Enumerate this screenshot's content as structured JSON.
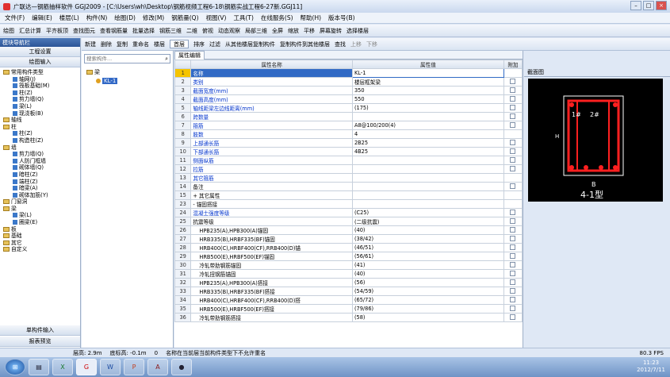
{
  "window": {
    "title": "广联达—钢筋抽样软件 GGJ2009 - [C:\\Users\\wh\\Desktop\\钢筋视频工程6-18\\钢筋实战工程6-27新.GGJ11]"
  },
  "menu": [
    "文件(F)",
    "编辑(E)",
    "楼层(L)",
    "构件(N)",
    "绘图(D)",
    "修改(M)",
    "钢筋量(Q)",
    "视图(V)",
    "工具(T)",
    "在线服务(S)",
    "帮助(H)",
    "版本号(B)"
  ],
  "toolbar1": [
    "绘图",
    "汇总计算",
    "平齐板顶",
    "查找图元",
    "查看钢筋量",
    "批量选择",
    "钢筋三维",
    "二维",
    "俯视",
    "动态观察",
    "局部三维",
    "全屏",
    "缩放",
    "平移",
    "屏幕旋转",
    "选择楼层"
  ],
  "toolbar2": {
    "new": "新建",
    "delete": "删除",
    "copy": "复制",
    "rename": "重命名",
    "floor_label": "楼层",
    "floor_value": "首层",
    "sort": "排序",
    "filter": "过滤",
    "copy_from": "从其他楼层复制构件",
    "copy_to": "复制构件到其他楼层",
    "find": "查找",
    "up": "上移",
    "down": "下移"
  },
  "left": {
    "title": "模块导航栏",
    "btn1": "工程设置",
    "btn2": "绘图输入",
    "bottom1": "单构件输入",
    "bottom2": "报表预览",
    "tree": [
      {
        "t": "常用构件类型",
        "lvl": 0,
        "k": "f"
      },
      {
        "t": "轴网(J)",
        "lvl": 1,
        "k": "c"
      },
      {
        "t": "筏板基础(M)",
        "lvl": 1,
        "k": "c"
      },
      {
        "t": "柱(Z)",
        "lvl": 1,
        "k": "c"
      },
      {
        "t": "剪力墙(Q)",
        "lvl": 1,
        "k": "c"
      },
      {
        "t": "梁(L)",
        "lvl": 1,
        "k": "c"
      },
      {
        "t": "现浇板(B)",
        "lvl": 1,
        "k": "c"
      },
      {
        "t": "轴线",
        "lvl": 0,
        "k": "f"
      },
      {
        "t": "柱",
        "lvl": 0,
        "k": "f"
      },
      {
        "t": "柱(Z)",
        "lvl": 1,
        "k": "c"
      },
      {
        "t": "构造柱(Z)",
        "lvl": 1,
        "k": "c"
      },
      {
        "t": "墙",
        "lvl": 0,
        "k": "f"
      },
      {
        "t": "剪力墙(Q)",
        "lvl": 1,
        "k": "c"
      },
      {
        "t": "人防门框墙",
        "lvl": 1,
        "k": "c"
      },
      {
        "t": "砌体墙(Q)",
        "lvl": 1,
        "k": "c"
      },
      {
        "t": "暗柱(Z)",
        "lvl": 1,
        "k": "c"
      },
      {
        "t": "端柱(Z)",
        "lvl": 1,
        "k": "c"
      },
      {
        "t": "暗梁(A)",
        "lvl": 1,
        "k": "c"
      },
      {
        "t": "砌体加筋(Y)",
        "lvl": 1,
        "k": "c"
      },
      {
        "t": "门窗洞",
        "lvl": 0,
        "k": "f"
      },
      {
        "t": "梁",
        "lvl": 0,
        "k": "f"
      },
      {
        "t": "梁(L)",
        "lvl": 1,
        "k": "c"
      },
      {
        "t": "圈梁(E)",
        "lvl": 1,
        "k": "c"
      },
      {
        "t": "板",
        "lvl": 0,
        "k": "f"
      },
      {
        "t": "基础",
        "lvl": 0,
        "k": "f"
      },
      {
        "t": "其它",
        "lvl": 0,
        "k": "f"
      },
      {
        "t": "自定义",
        "lvl": 0,
        "k": "f"
      }
    ]
  },
  "mid": {
    "search_placeholder": "搜索构件...",
    "root": "梁",
    "child": "KL-1"
  },
  "grid": {
    "tab": "属性编辑",
    "headers": [
      "属性名称",
      "属性值",
      "附加"
    ],
    "rows": [
      [
        "1",
        "名称",
        "KL-1",
        0
      ],
      [
        "2",
        "类别",
        "楼层框架梁",
        1
      ],
      [
        "3",
        "截面宽度(mm)",
        "350",
        1
      ],
      [
        "4",
        "截面高度(mm)",
        "550",
        1
      ],
      [
        "5",
        "轴线距梁左边线距离(mm)",
        "(175)",
        1
      ],
      [
        "6",
        "跨数量",
        "",
        1
      ],
      [
        "7",
        "箍筋",
        "A8@100/200(4)",
        1
      ],
      [
        "8",
        "肢数",
        "4",
        0
      ],
      [
        "9",
        "上部通长筋",
        "2B25",
        1
      ],
      [
        "10",
        "下部通长筋",
        "4B25",
        1
      ],
      [
        "11",
        "侧面纵筋",
        "",
        1
      ],
      [
        "12",
        "拉筋",
        "",
        1
      ],
      [
        "13",
        "其它箍筋",
        "",
        0
      ],
      [
        "14",
        "备注",
        "",
        1
      ],
      [
        "15",
        "+ 其它属性",
        "",
        0
      ],
      [
        "23",
        "- 锚固搭接",
        "",
        0
      ],
      [
        "24",
        "混凝土强度等级",
        "(C25)",
        1
      ],
      [
        "25",
        "抗震等级",
        "(二级抗震)",
        1
      ],
      [
        "26",
        "HPB235(A),HPB300(A)锚固",
        "(40)",
        1
      ],
      [
        "27",
        "HRB335(B),HRBF335(BF)锚固",
        "(38/42)",
        1
      ],
      [
        "28",
        "HRB400(C),HRBF400(CF),RRB400(D)锚",
        "(46/51)",
        1
      ],
      [
        "29",
        "HRB500(E),HRBF500(EF)锚固",
        "(56/61)",
        1
      ],
      [
        "30",
        "冷轧带肋钢筋锚固",
        "(41)",
        1
      ],
      [
        "31",
        "冷轧扭钢筋锚固",
        "(40)",
        1
      ],
      [
        "32",
        "HPB235(A),HPB300(A)搭接",
        "(56)",
        1
      ],
      [
        "33",
        "HRB335(B),HRBF335(BF)搭接",
        "(54/59)",
        1
      ],
      [
        "34",
        "HRB400(C),HRBF400(CF),RRB400(D)搭",
        "(65/72)",
        1
      ],
      [
        "35",
        "HRB500(E),HRBF500(EF)搭接",
        "(79/86)",
        1
      ],
      [
        "36",
        "冷轧带肋钢筋搭接",
        "(58)",
        1
      ]
    ]
  },
  "preview": {
    "title": "截面图",
    "label1": "1#",
    "label2": "2#",
    "h": "H",
    "b": "B",
    "type": "4-1型"
  },
  "status": {
    "floor_h": "层高: 2.9m",
    "floor_base": "底标高: -0.1m",
    "zero": "0",
    "msg": "名称在当前层当前构件类型下不允许重名",
    "fps": "80.3 FPS"
  },
  "clock": {
    "time": "11:23",
    "date": "2012/7/11"
  },
  "colors": {
    "title": "#2c5597",
    "rebar": "#ff2020"
  }
}
